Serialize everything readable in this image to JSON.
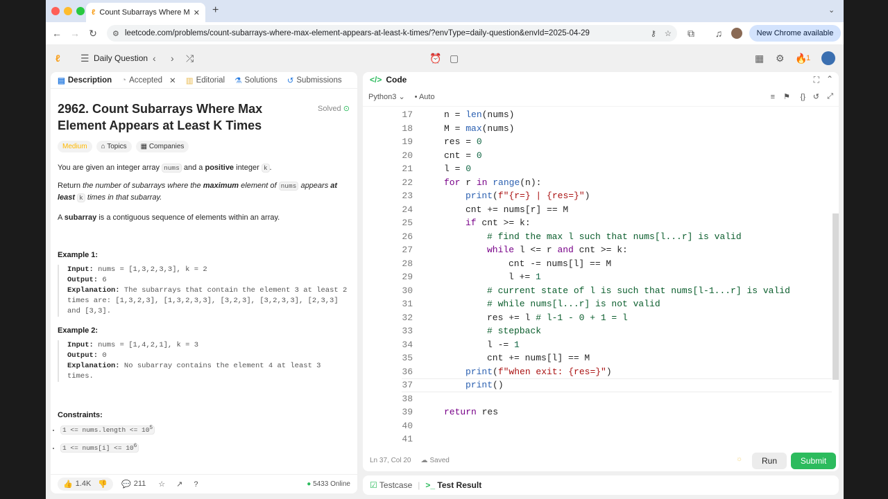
{
  "browser": {
    "tab_title": "Count Subarrays Where Max E",
    "url": "leetcode.com/problems/count-subarrays-where-max-element-appears-at-least-k-times/?envType=daily-question&envId=2025-04-29",
    "new_chrome": "New Chrome available",
    "colors": {
      "close": "#ff5f57",
      "min": "#febc2e",
      "max": "#28c840"
    }
  },
  "lc_header": {
    "title": "Daily Question",
    "streak": "1"
  },
  "left": {
    "tabs": [
      "Description",
      "Accepted",
      "Editorial",
      "Solutions",
      "Submissions"
    ],
    "title": "2962. Count Subarrays Where Max Element Appears at Least K Times",
    "solved": "Solved",
    "difficulty": "Medium",
    "topics": "Topics",
    "companies": "Companies",
    "p1_a": "You are given an integer array ",
    "p1_code1": "nums",
    "p1_b": " and a ",
    "p1_bold": "positive",
    "p1_c": " integer ",
    "p1_code2": "k",
    "p1_d": ".",
    "p2_a": "Return ",
    "p2_i1": "the number of subarrays where the ",
    "p2_b1": "maximum",
    "p2_i2": " element of ",
    "p2_code": "nums",
    "p2_i3": " appears ",
    "p2_b2": "at least",
    "p2_code2": "k",
    "p2_i4": " times in that subarray.",
    "p3_a": "A ",
    "p3_bold": "subarray",
    "p3_b": " is a contiguous sequence of elements within an array.",
    "ex1_h": "Example 1:",
    "ex1": {
      "in_l": "Input:",
      "in": " nums = [1,3,2,3,3], k = 2",
      "out_l": "Output:",
      "out": " 6",
      "exp_l": "Explanation:",
      "exp": " The subarrays that contain the element 3 at least 2 times are: [1,3,2,3], [1,3,2,3,3], [3,2,3], [3,2,3,3], [2,3,3] and [3,3]."
    },
    "ex2_h": "Example 2:",
    "ex2": {
      "in_l": "Input:",
      "in": " nums = [1,4,2,1], k = 3",
      "out_l": "Output:",
      "out": " 0",
      "exp_l": "Explanation:",
      "exp": " No subarray contains the element 4 at least 3 times."
    },
    "cons_h": "Constraints:",
    "cons": [
      {
        "a": "1 <= nums.length <= 10",
        "sup": "5"
      },
      {
        "a": "1 <= nums[i] <= 10",
        "sup": "6"
      }
    ],
    "footer": {
      "likes": "1.4K",
      "comments": "211",
      "online": "5433 Online"
    }
  },
  "right": {
    "title": "Code",
    "language": "Python3",
    "mode": "Auto",
    "status_pos": "Ln 37, Col 20",
    "status_saved": "Saved",
    "run": "Run",
    "submit": "Submit",
    "bottom_tabs": [
      "Testcase",
      "Test Result"
    ],
    "code_lines": [
      {
        "n": "17",
        "html": "n = <span class=\"fn\">len</span>(nums)",
        "indent": 2
      },
      {
        "n": "18",
        "html": "M = <span class=\"fn\">max</span>(nums)",
        "indent": 2
      },
      {
        "n": "19",
        "html": "res = <span class=\"nm\">0</span>",
        "indent": 2
      },
      {
        "n": "20",
        "html": "cnt = <span class=\"nm\">0</span>",
        "indent": 2
      },
      {
        "n": "21",
        "html": "l = <span class=\"nm\">0</span>",
        "indent": 2
      },
      {
        "n": "22",
        "html": "<span class=\"kw\">for</span> r <span class=\"kw\">in</span> <span class=\"fn\">range</span>(n):",
        "indent": 2
      },
      {
        "n": "23",
        "html": "<span class=\"fn\">print</span>(<span class=\"st\">f\"{r=} | {res=}\"</span>)",
        "indent": 3
      },
      {
        "n": "24",
        "html": "cnt += nums[r] == M",
        "indent": 3
      },
      {
        "n": "25",
        "html": "<span class=\"kw\">if</span> cnt >= k:",
        "indent": 3
      },
      {
        "n": "26",
        "html": "<span class=\"cm\"># find the max l such that nums[l...r] is valid</span>",
        "indent": 4
      },
      {
        "n": "27",
        "html": "<span class=\"kw\">while</span> l <= r <span class=\"kw\">and</span> cnt >= k:",
        "indent": 4
      },
      {
        "n": "28",
        "html": "cnt -= nums[l] == M",
        "indent": 5
      },
      {
        "n": "29",
        "html": "l += <span class=\"nm\">1</span>",
        "indent": 5
      },
      {
        "n": "30",
        "html": "<span class=\"cm\"># current state of l is such that nums[l-1...r] is valid</span>",
        "indent": 4
      },
      {
        "n": "31",
        "html": "<span class=\"cm\"># while nums[l...r] is not valid</span>",
        "indent": 4
      },
      {
        "n": "32",
        "html": "res += l <span class=\"cm\"># l-1 - 0 + 1 = l</span>",
        "indent": 4
      },
      {
        "n": "33",
        "html": "<span class=\"cm\"># stepback</span>",
        "indent": 4
      },
      {
        "n": "34",
        "html": "l -= <span class=\"nm\">1</span>",
        "indent": 4
      },
      {
        "n": "35",
        "html": "cnt += nums[l] == M",
        "indent": 4
      },
      {
        "n": "36",
        "html": "<span class=\"fn\">print</span>(<span class=\"st\">f\"when exit: {res=}\"</span>)",
        "indent": 3
      },
      {
        "n": "37",
        "html": "<span class=\"fn\">print</span>()",
        "indent": 3
      },
      {
        "n": "38",
        "html": "",
        "indent": 2
      },
      {
        "n": "39",
        "html": "<span class=\"kw\">return</span> res",
        "indent": 2
      },
      {
        "n": "40",
        "html": "",
        "indent": 2
      },
      {
        "n": "41",
        "html": "",
        "indent": 2
      }
    ]
  }
}
